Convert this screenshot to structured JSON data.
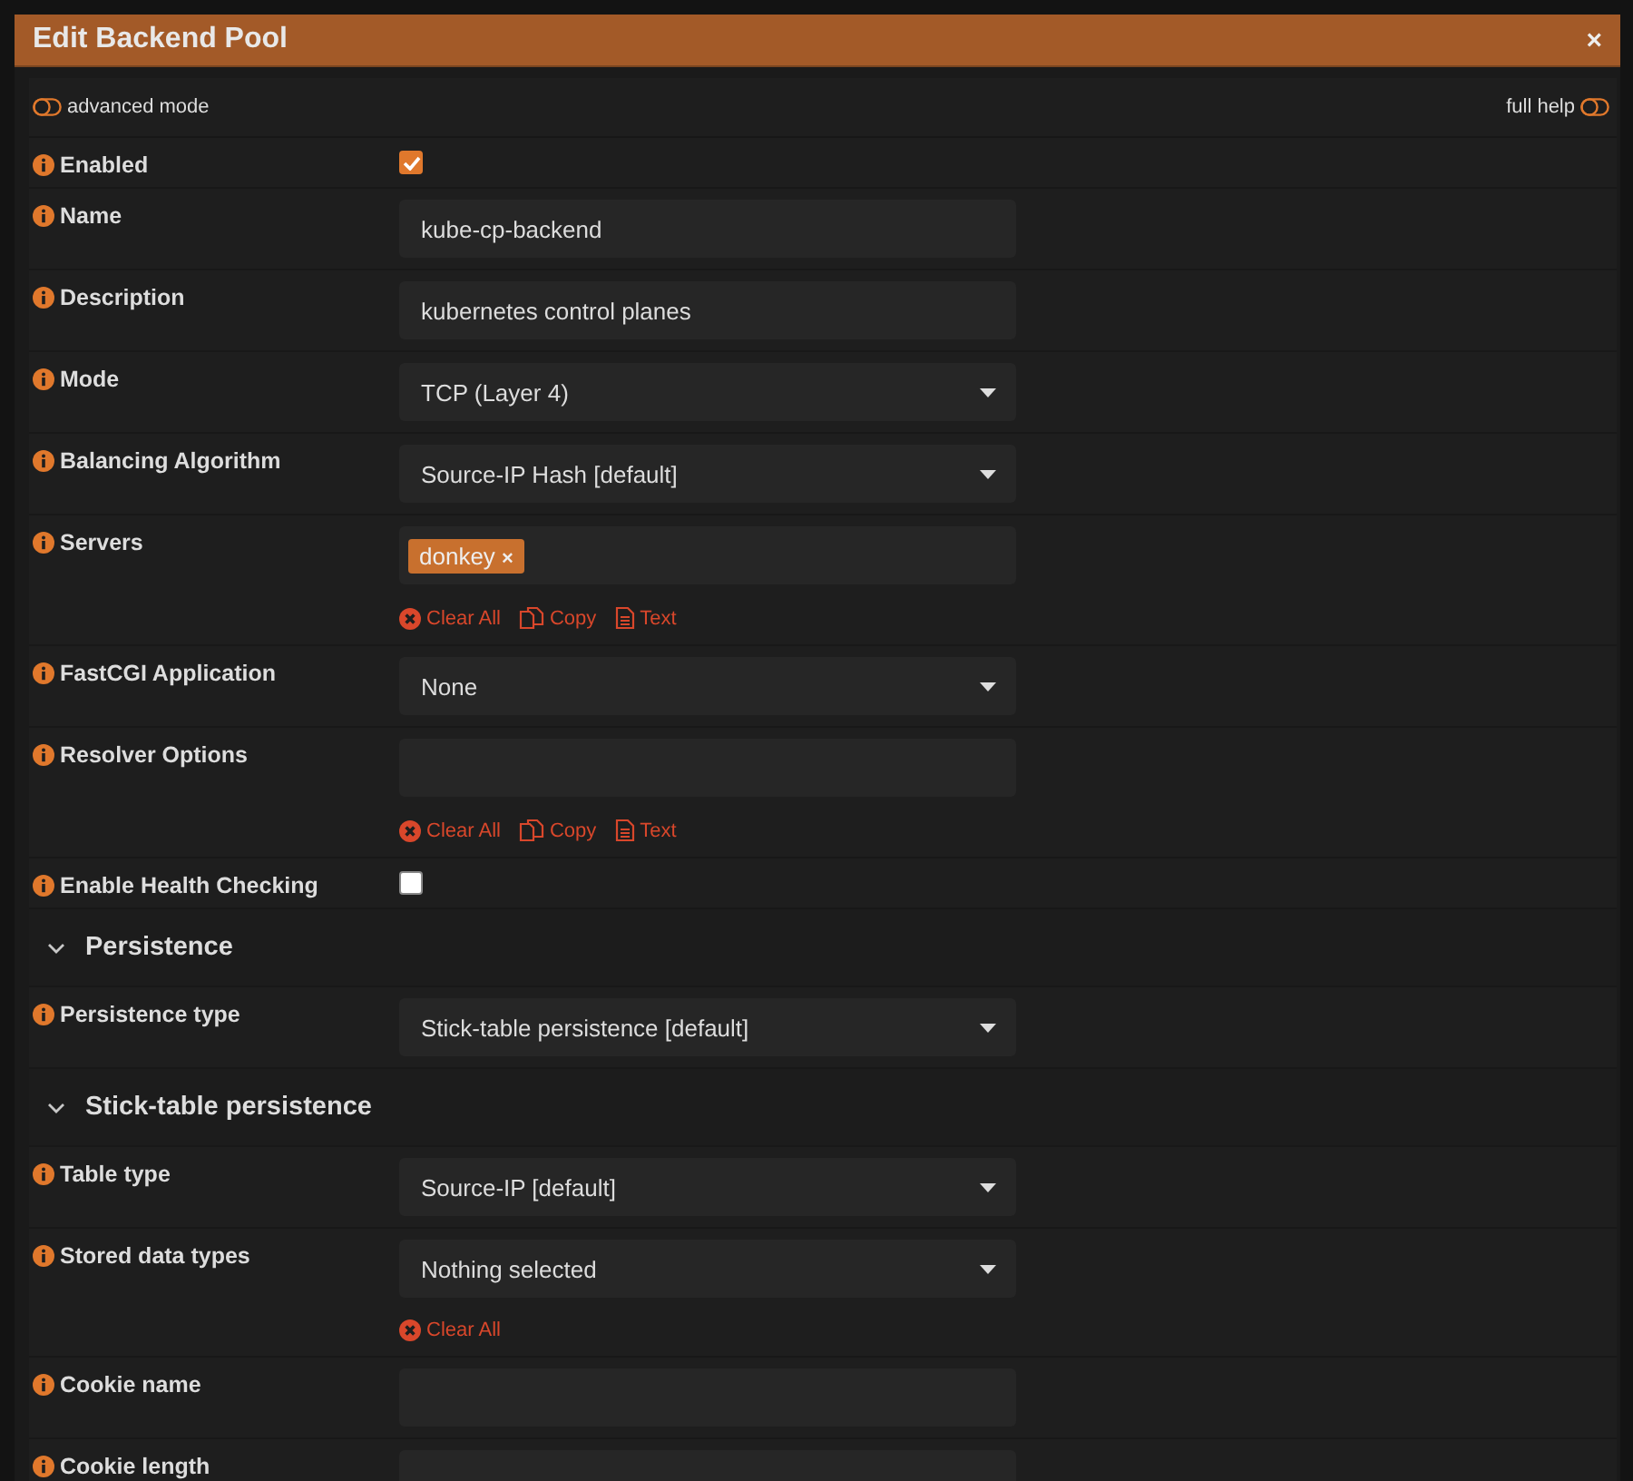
{
  "dialog": {
    "title": "Edit Backend Pool",
    "close": "×"
  },
  "toolbar": {
    "advanced_mode": {
      "label": "advanced mode",
      "on": false
    },
    "full_help": {
      "label": "full help",
      "on": false
    }
  },
  "rows": [
    {
      "kind": "checkbox",
      "label": "Enabled",
      "checked": true
    },
    {
      "kind": "text",
      "label": "Name",
      "value": "kube-cp-backend"
    },
    {
      "kind": "text",
      "label": "Description",
      "value": "kubernetes control planes"
    },
    {
      "kind": "select",
      "label": "Mode",
      "value": "TCP (Layer 4)"
    },
    {
      "kind": "select",
      "label": "Balancing Algorithm",
      "value": "Source-IP Hash [default]"
    },
    {
      "kind": "tags",
      "label": "Servers",
      "tags": [
        {
          "text": "donkey",
          "remove": "×"
        }
      ],
      "actions": [
        {
          "kind": "clear",
          "label": "Clear All"
        },
        {
          "kind": "copy",
          "label": "Copy"
        },
        {
          "kind": "text",
          "label": "Text"
        }
      ]
    },
    {
      "kind": "select",
      "label": "FastCGI Application",
      "value": "None"
    },
    {
      "kind": "tags",
      "label": "Resolver Options",
      "tags": [],
      "actions": [
        {
          "kind": "clear",
          "label": "Clear All"
        },
        {
          "kind": "copy",
          "label": "Copy"
        },
        {
          "kind": "text",
          "label": "Text"
        }
      ]
    },
    {
      "kind": "checkbox",
      "label": "Enable Health Checking",
      "checked": false
    },
    {
      "kind": "section",
      "label": "Persistence"
    },
    {
      "kind": "select",
      "label": "Persistence type",
      "value": "Stick-table persistence [default]"
    },
    {
      "kind": "section",
      "label": "Stick-table persistence"
    },
    {
      "kind": "select",
      "label": "Table type",
      "value": "Source-IP [default]"
    },
    {
      "kind": "select",
      "label": "Stored data types",
      "value": "Nothing selected",
      "actions": [
        {
          "kind": "clear",
          "label": "Clear All"
        }
      ]
    },
    {
      "kind": "text",
      "label": "Cookie name",
      "value": ""
    },
    {
      "kind": "text",
      "label": "Cookie length",
      "value": ""
    }
  ]
}
